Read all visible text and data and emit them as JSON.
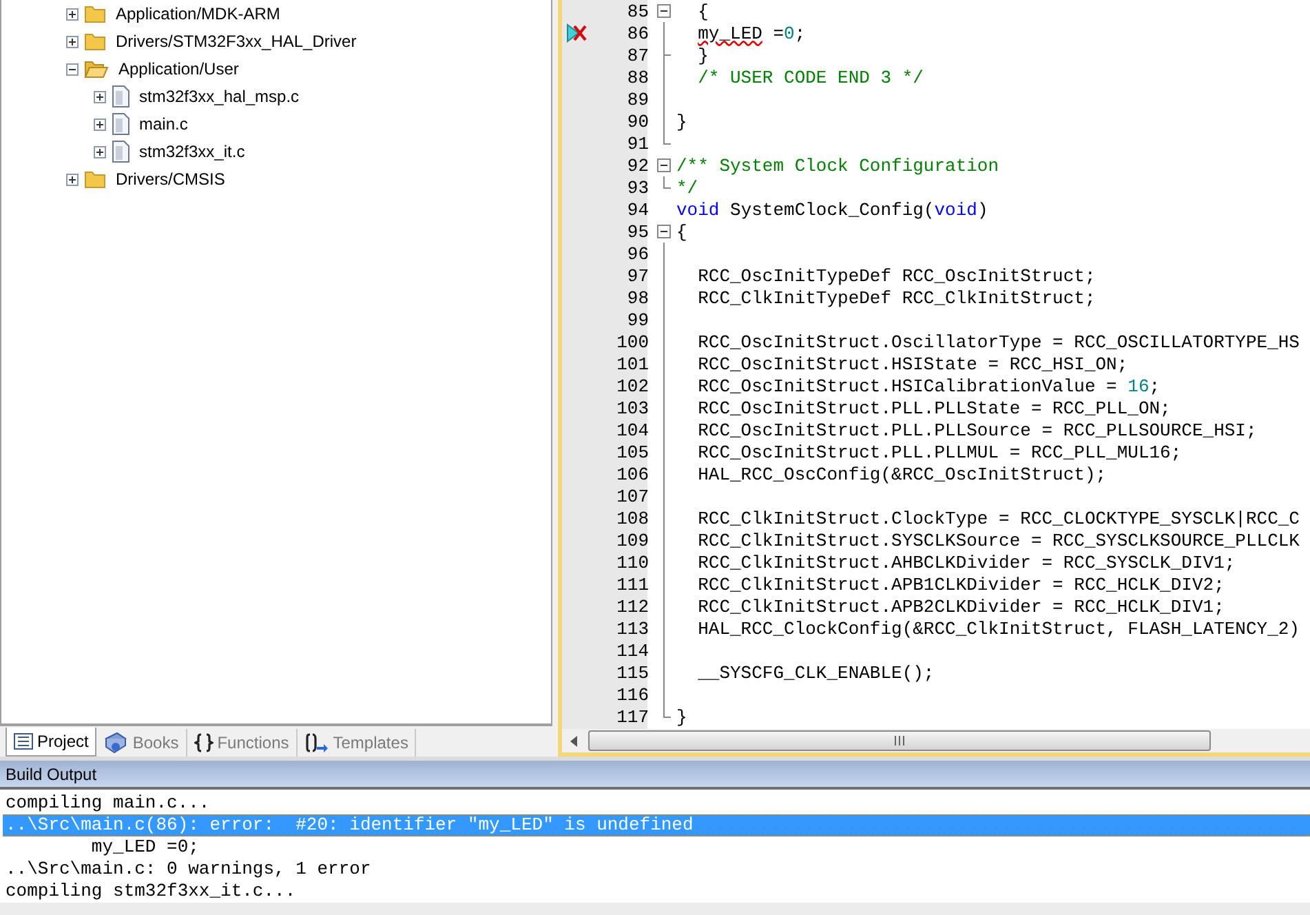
{
  "project_tree": [
    {
      "label": "Application/MDK-ARM",
      "kind": "folder",
      "expanded": false
    },
    {
      "label": "Drivers/STM32F3xx_HAL_Driver",
      "kind": "folder",
      "expanded": false
    },
    {
      "label": "Application/User",
      "kind": "folder",
      "expanded": true,
      "children": [
        {
          "label": "stm32f3xx_hal_msp.c",
          "kind": "file",
          "expanded": false
        },
        {
          "label": "main.c",
          "kind": "file",
          "expanded": false
        },
        {
          "label": "stm32f3xx_it.c",
          "kind": "file",
          "expanded": false
        }
      ]
    },
    {
      "label": "Drivers/CMSIS",
      "kind": "folder",
      "expanded": false
    }
  ],
  "panel_tabs": [
    {
      "label": "Project",
      "selected": true
    },
    {
      "label": "Books",
      "selected": false
    },
    {
      "label": "Functions",
      "selected": false
    },
    {
      "label": "Templates",
      "selected": false
    }
  ],
  "editor": {
    "lines": [
      {
        "number": "85",
        "kind": "fold-start",
        "error": false,
        "code": [
          {
            "text": "  {",
            "kind": "plain"
          }
        ]
      },
      {
        "number": "86",
        "kind": "fold-body",
        "error": true,
        "code": [
          {
            "text": "  my_LED",
            "kind": "error"
          },
          {
            "text": " =",
            "kind": "plain"
          },
          {
            "text": "0",
            "kind": "number"
          },
          {
            "text": ";",
            "kind": "plain"
          }
        ]
      },
      {
        "number": "87",
        "kind": "fold-tee",
        "error": false,
        "code": [
          {
            "text": "  }",
            "kind": "plain"
          }
        ]
      },
      {
        "number": "88",
        "kind": "fold-body",
        "error": false,
        "code": [
          {
            "text": "  /* USER CODE END 3 */",
            "kind": "comment"
          }
        ]
      },
      {
        "number": "89",
        "kind": "fold-body",
        "error": false
      },
      {
        "number": "90",
        "kind": "fold-body",
        "error": false,
        "code": [
          {
            "text": "}",
            "kind": "plain"
          }
        ]
      },
      {
        "number": "91",
        "kind": "fold-end",
        "error": false
      },
      {
        "number": "92",
        "kind": "fold-start",
        "error": false,
        "code": [
          {
            "text": "/** System Clock Configuration",
            "kind": "comment"
          }
        ]
      },
      {
        "number": "93",
        "kind": "fold-end",
        "error": false,
        "code": [
          {
            "text": "*/",
            "kind": "comment"
          }
        ]
      },
      {
        "number": "94",
        "kind": "plain",
        "error": false,
        "code": [
          {
            "text": "void",
            "kind": "keyword"
          },
          {
            "text": " SystemClock_Config(",
            "kind": "plain"
          },
          {
            "text": "void",
            "kind": "keyword"
          },
          {
            "text": ")",
            "kind": "plain"
          }
        ]
      },
      {
        "number": "95",
        "kind": "fold-start",
        "error": false,
        "code": [
          {
            "text": "{",
            "kind": "plain"
          }
        ]
      },
      {
        "number": "96",
        "kind": "fold-body",
        "error": false
      },
      {
        "number": "97",
        "kind": "fold-body",
        "error": false,
        "code": [
          {
            "text": "  RCC_OscInitTypeDef RCC_OscInitStruct;",
            "kind": "plain"
          }
        ]
      },
      {
        "number": "98",
        "kind": "fold-body",
        "error": false,
        "code": [
          {
            "text": "  RCC_ClkInitTypeDef RCC_ClkInitStruct;",
            "kind": "plain"
          }
        ]
      },
      {
        "number": "99",
        "kind": "fold-body",
        "error": false
      },
      {
        "number": "100",
        "kind": "fold-body",
        "error": false,
        "code": [
          {
            "text": "  RCC_OscInitStruct.OscillatorType = RCC_OSCILLATORTYPE_HS",
            "kind": "plain"
          }
        ]
      },
      {
        "number": "101",
        "kind": "fold-body",
        "error": false,
        "code": [
          {
            "text": "  RCC_OscInitStruct.HSIState = RCC_HSI_ON;",
            "kind": "plain"
          }
        ]
      },
      {
        "number": "102",
        "kind": "fold-body",
        "error": false,
        "code": [
          {
            "text": "  RCC_OscInitStruct.HSICalibrationValue = ",
            "kind": "plain"
          },
          {
            "text": "16",
            "kind": "number"
          },
          {
            "text": ";",
            "kind": "plain"
          }
        ]
      },
      {
        "number": "103",
        "kind": "fold-body",
        "error": false,
        "code": [
          {
            "text": "  RCC_OscInitStruct.PLL.PLLState = RCC_PLL_ON;",
            "kind": "plain"
          }
        ]
      },
      {
        "number": "104",
        "kind": "fold-body",
        "error": false,
        "code": [
          {
            "text": "  RCC_OscInitStruct.PLL.PLLSource = RCC_PLLSOURCE_HSI;",
            "kind": "plain"
          }
        ]
      },
      {
        "number": "105",
        "kind": "fold-body",
        "error": false,
        "code": [
          {
            "text": "  RCC_OscInitStruct.PLL.PLLMUL = RCC_PLL_MUL16;",
            "kind": "plain"
          }
        ]
      },
      {
        "number": "106",
        "kind": "fold-body",
        "error": false,
        "code": [
          {
            "text": "  HAL_RCC_OscConfig(&RCC_OscInitStruct);",
            "kind": "plain"
          }
        ]
      },
      {
        "number": "107",
        "kind": "fold-body",
        "error": false
      },
      {
        "number": "108",
        "kind": "fold-body",
        "error": false,
        "code": [
          {
            "text": "  RCC_ClkInitStruct.ClockType = RCC_CLOCKTYPE_SYSCLK|RCC_C",
            "kind": "plain"
          }
        ]
      },
      {
        "number": "109",
        "kind": "fold-body",
        "error": false,
        "code": [
          {
            "text": "  RCC_ClkInitStruct.SYSCLKSource = RCC_SYSCLKSOURCE_PLLCLK",
            "kind": "plain"
          }
        ]
      },
      {
        "number": "110",
        "kind": "fold-body",
        "error": false,
        "code": [
          {
            "text": "  RCC_ClkInitStruct.AHBCLKDivider = RCC_SYSCLK_DIV1;",
            "kind": "plain"
          }
        ]
      },
      {
        "number": "111",
        "kind": "fold-body",
        "error": false,
        "code": [
          {
            "text": "  RCC_ClkInitStruct.APB1CLKDivider = RCC_HCLK_DIV2;",
            "kind": "plain"
          }
        ]
      },
      {
        "number": "112",
        "kind": "fold-body",
        "error": false,
        "code": [
          {
            "text": "  RCC_ClkInitStruct.APB2CLKDivider = RCC_HCLK_DIV1;",
            "kind": "plain"
          }
        ]
      },
      {
        "number": "113",
        "kind": "fold-body",
        "error": false,
        "code": [
          {
            "text": "  HAL_RCC_ClockConfig(&RCC_ClkInitStruct, FLASH_LATENCY_2)",
            "kind": "plain"
          }
        ]
      },
      {
        "number": "114",
        "kind": "fold-body",
        "error": false
      },
      {
        "number": "115",
        "kind": "fold-body",
        "error": false,
        "code": [
          {
            "text": "  __SYSCFG_CLK_ENABLE();",
            "kind": "plain"
          }
        ]
      },
      {
        "number": "116",
        "kind": "fold-body",
        "error": false
      },
      {
        "number": "117",
        "kind": "fold-end",
        "error": false,
        "code": [
          {
            "text": "}",
            "kind": "plain"
          }
        ]
      }
    ]
  },
  "build_output": {
    "title": "Build Output",
    "lines": [
      {
        "text": "compiling main.c...",
        "selected": false
      },
      {
        "text": "..\\Src\\main.c(86): error:  #20: identifier \"my_LED\" is undefined",
        "selected": true
      },
      {
        "text": "        my_LED =0;",
        "selected": false
      },
      {
        "text": "..\\Src\\main.c: 0 warnings, 1 error",
        "selected": false
      },
      {
        "text": "compiling stm32f3xx_it.c...",
        "selected": false
      }
    ]
  }
}
